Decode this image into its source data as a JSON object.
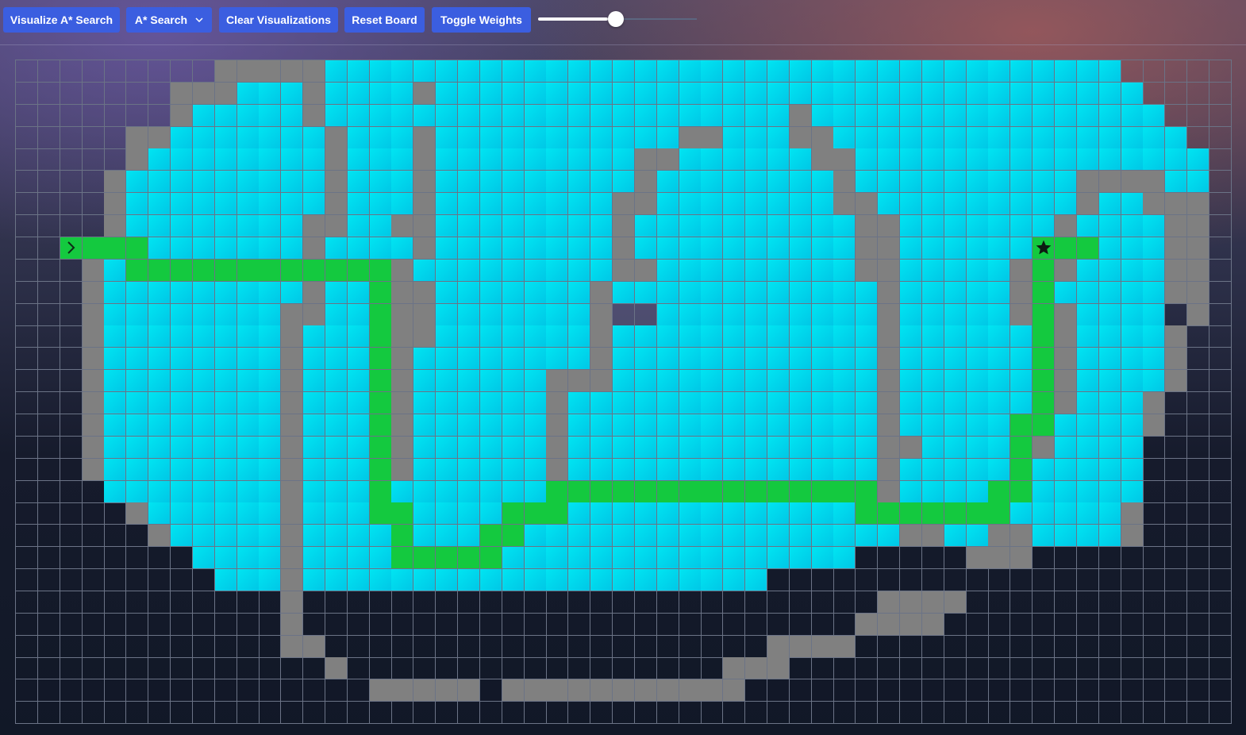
{
  "toolbar": {
    "visualize_label": "Visualize A* Search",
    "algorithm_label": "A* Search",
    "clear_label": "Clear Visualizations",
    "reset_label": "Reset Board",
    "weights_label": "Toggle Weights"
  },
  "speed_slider": {
    "value": 0.44
  },
  "grid": {
    "cols": 55,
    "rows": 30,
    "start": [
      8,
      2
    ],
    "finish": [
      8,
      46
    ],
    "start_icon": "chevron-right-icon",
    "finish_icon": "star-icon",
    "legend": {
      "e": "unvisited",
      "w": "wall",
      "v": "visited",
      "p": "path",
      "x": "unvisited-highlight"
    },
    "colors": {
      "visited": "#00d7ec",
      "path": "#14c93f",
      "wall": "#808080",
      "border": "#6b7386"
    },
    "layout": [
      "eeeeeeeeewwwwwvvvvvvvvvvvvvvvvvvvvvvvvvvvvvvvvvvvveeeee",
      "eeeeeeewwwvvvwvvvvwvvvvvvvvvvvvvvvvvvvvvvvvvvvvvvvveeee",
      "eeeeeeewvvvvvwvvvvvvvvvvvvvvvvvvvvvwvvvvvvvvvvvvvvvveeee",
      "eeeeewwvvvvvvvwvvvwvvvvvvvvvvvwwvvvwwvvvvvvvvvvvvvvvveee",
      "eeeeewvvvvvvvvwvvvwvvvvvvvvvwwvvvvvvwwvvvvvvvvvvvvvvvvee",
      "eeeewvvvvvvvvvwvvvwvvvvvvvvvwvvvvvvvvwvvvvvvvvvvwwwwvvee",
      "eeeewvvvvvvvvvwvvvwvvvvvvvvwwvvvvvvvvwwvvvvvvvvvwvvwwwee",
      "eeeewvvvvvvvvwwvvwwvvvvvvvvwvvvvvvvvvvwwvvvvvvvwvvvvwwee",
      "eeewwvvvvvvvvwvvvvwvvvvvvvvwvvvvvvvvvvwwvvvvvvvwvvvvwwee",
      "eeewvvvvvvvvvwvvvwvvvvvvvvvwwvvvvvvvvvwwvvvvvwwwvvvvwwee",
      "eeewvvvvvvvvvwvvvwwvvvvvvvwvvvvvvvvvvvvwvvvvvwvvvvvvwwee",
      "eeewvvvvvvvvwwvvvwwvvvvvvvwxxvvvvvvvvvvwvvvvvwwwvvvvewee",
      "eeewvvvvvvvvwvvvvwwvvvvvvvwvvvvvvvvvvvvwvvvvvvvwvvvvweee",
      "eeewvvvvvvvvwvvvvwvvvvvvvvwvvvvvvvvvvvvwvvvvvvvwvvvvweee",
      "eeewvvvvvvvvwvvvvwvvvvvvwwwvvvvvvvvvvvvwvvvvvvvwvvvvweee",
      "eeewvvvvvvvvwvvvvwvvvvvvwvvvvvvvvvvvvvvwvvvvvvvwvvvweeee",
      "eeewvvvvvvvvwvvvvwvvvvvvwvvvvvvvvvvvvvvwvvvvvvwvvvvweeee",
      "eeewvvvvvvvvwvvvvwvvvvvvwvvvvvvvvvvvvvvwwvvvvwwvvvveeeee",
      "eeewvvvvvvvvwvvvvwvvvvvvwvvvvvvvvvvvvvvwvvvvvwvvvvveeeee",
      "eeeevvvvvvvvwvvvvvvvvvvvwvvvvvvvvvvvvvvwvvvvwwvvvvveeeee",
      "eeeeewvvvvvvwvvvvwvvvvvvwvvvvvvvvvvvvvvwvvvvwvvvvvweeeee",
      "eeeeeewvvvvvwvvvvvvvvvvvvvvvvvvvvvvvvvvvwwvvwwvvvvweeeee",
      "eeeeeeeevvvvwvvvvvvvvvvvvvvvvvvvvvvvvveeeeewwweeeeeeeeee",
      "eeeeeeeeevvvwvvvvvvvvvvvvvvvvvvvvveeeeeeeeeeeeeeeeeeeeee",
      "eeeeeeeeeeeeweeeeeeeeeeeeeeeeeeeeeeeeeewwwweeeeeeeeeeeee",
      "eeeeeeeeeeeeweeeeeeeeeeeeeeeeeeeeeeeeewwwweeeeeeeeeeeeee",
      "eeeeeeeeeeeewweeeeeeeeeeeeeeeeeeeewwwweeeeeeeeeeeeeeeeee",
      "eeeeeeeeeeeeeeweeeeeeeeeeeeeeeeewwweeeeeeeeeeeeeeeeeeeee",
      "eeeeeeeeeeeeeeeewwwwwewwwwwwwwwwweeeeeeeeeeeeeeeeeeeeeee",
      "eeeeeeeeeeeeeeeeeeeeeeeeeeeeeeeeeeeeeeeeeeeeeeeeeeeeeeee"
    ],
    "path": [
      [
        8,
        2
      ],
      [
        8,
        3
      ],
      [
        8,
        4
      ],
      [
        8,
        5
      ],
      [
        9,
        5
      ],
      [
        9,
        6
      ],
      [
        9,
        7
      ],
      [
        9,
        8
      ],
      [
        9,
        9
      ],
      [
        9,
        10
      ],
      [
        9,
        11
      ],
      [
        9,
        12
      ],
      [
        9,
        13
      ],
      [
        9,
        14
      ],
      [
        9,
        15
      ],
      [
        9,
        16
      ],
      [
        10,
        16
      ],
      [
        11,
        16
      ],
      [
        12,
        16
      ],
      [
        13,
        16
      ],
      [
        14,
        16
      ],
      [
        15,
        16
      ],
      [
        16,
        16
      ],
      [
        17,
        16
      ],
      [
        18,
        16
      ],
      [
        19,
        16
      ],
      [
        20,
        16
      ],
      [
        20,
        17
      ],
      [
        21,
        17
      ],
      [
        22,
        17
      ],
      [
        22,
        18
      ],
      [
        22,
        19
      ],
      [
        22,
        20
      ],
      [
        22,
        21
      ],
      [
        21,
        21
      ],
      [
        21,
        22
      ],
      [
        20,
        22
      ],
      [
        20,
        23
      ],
      [
        20,
        24
      ],
      [
        19,
        24
      ],
      [
        19,
        25
      ],
      [
        19,
        26
      ],
      [
        19,
        27
      ],
      [
        19,
        28
      ],
      [
        19,
        29
      ],
      [
        19,
        30
      ],
      [
        19,
        31
      ],
      [
        19,
        32
      ],
      [
        19,
        33
      ],
      [
        19,
        34
      ],
      [
        19,
        35
      ],
      [
        19,
        36
      ],
      [
        19,
        37
      ],
      [
        19,
        38
      ],
      [
        20,
        38
      ],
      [
        20,
        39
      ],
      [
        20,
        40
      ],
      [
        20,
        41
      ],
      [
        20,
        42
      ],
      [
        20,
        43
      ],
      [
        20,
        44
      ],
      [
        19,
        44
      ],
      [
        19,
        45
      ],
      [
        18,
        45
      ],
      [
        17,
        45
      ],
      [
        16,
        45
      ],
      [
        16,
        46
      ],
      [
        15,
        46
      ],
      [
        14,
        46
      ],
      [
        13,
        46
      ],
      [
        12,
        46
      ],
      [
        11,
        46
      ],
      [
        10,
        46
      ],
      [
        9,
        46
      ],
      [
        8,
        46
      ],
      [
        8,
        47
      ],
      [
        8,
        48
      ]
    ]
  }
}
